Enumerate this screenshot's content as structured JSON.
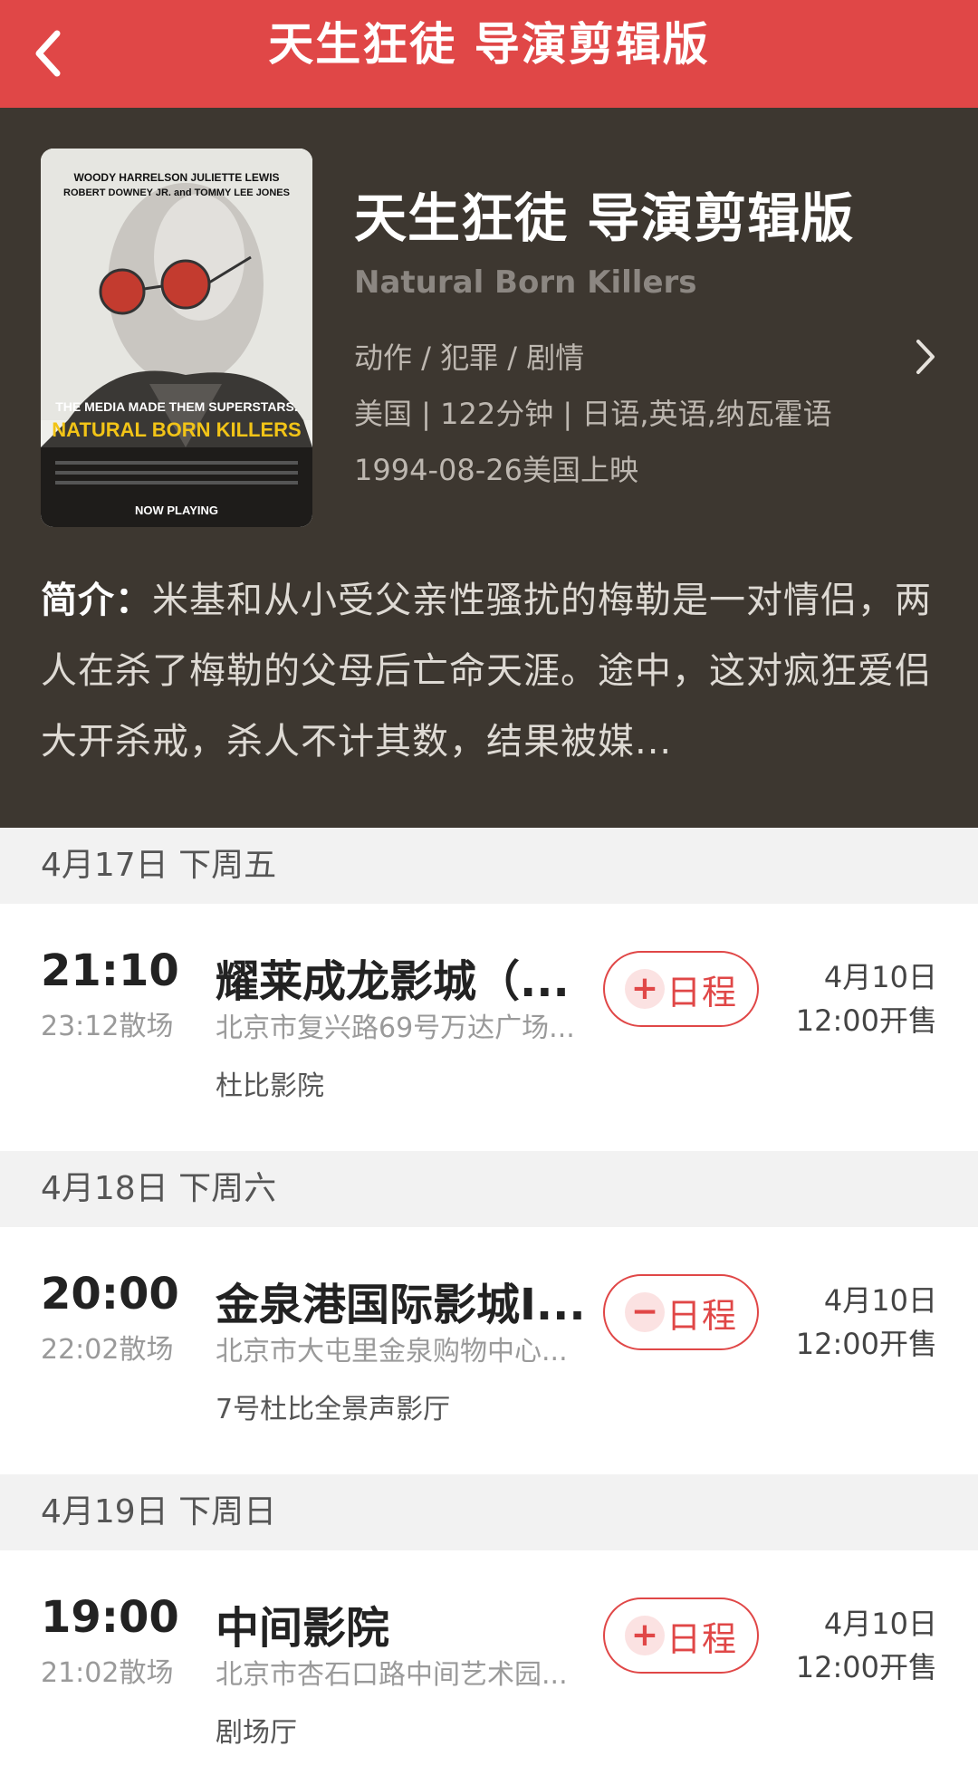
{
  "topbar": {
    "title": "天生狂徒 导演剪辑版"
  },
  "movie": {
    "cn_title": "天生狂徒 导演剪辑版",
    "en_title": "Natural Born Killers",
    "genre": "动作 / 犯罪 / 剧情",
    "meta": "美国 | 122分钟 | 日语,英语,纳瓦霍语",
    "release": "1994-08-26美国上映",
    "poster": {
      "cast_line1": "WOODY HARRELSON  JULIETTE LEWIS",
      "cast_line2": "ROBERT DOWNEY JR. and TOMMY LEE JONES",
      "tagline": "THE MEDIA MADE THEM SUPERSTARS.",
      "title": "NATURAL BORN KILLERS",
      "footer": "NOW PLAYING"
    },
    "synopsis_label": "简介：",
    "synopsis": "米基和从小受父亲性骚扰的梅勒是一对情侣，两人在杀了梅勒的父母后亡命天涯。途中，这对疯狂爱侣大开杀戒，杀人不计其数，结果被媒..."
  },
  "schedule": [
    {
      "day": "4月17日 下周五",
      "start": "21:10",
      "end": "23:12散场",
      "cinema": "耀莱成龙影城（...",
      "address": "北京市复兴路69号万达广场...",
      "hall": "杜比影院",
      "button_icon": "+",
      "button_label": "日程",
      "sale_date": "4月10日",
      "sale_time": "12:00开售"
    },
    {
      "day": "4月18日 下周六",
      "start": "20:00",
      "end": "22:02散场",
      "cinema": "金泉港国际影城I...",
      "address": "北京市大屯里金泉购物中心...",
      "hall": "7号杜比全景声影厅",
      "button_icon": "−",
      "button_label": "日程",
      "sale_date": "4月10日",
      "sale_time": "12:00开售"
    },
    {
      "day": "4月19日 下周日",
      "start": "19:00",
      "end": "21:02散场",
      "cinema": "中间影院",
      "address": "北京市杏石口路中间艺术园...",
      "hall": "剧场厅",
      "button_icon": "+",
      "button_label": "日程",
      "sale_date": "4月10日",
      "sale_time": "12:00开售"
    }
  ],
  "icons": {
    "back": "chevron-left-icon",
    "detail": "chevron-right-icon"
  },
  "colors": {
    "brand_red": "#e04747",
    "hero_bg": "#3d3730",
    "day_header_bg": "#f2f2f2"
  }
}
